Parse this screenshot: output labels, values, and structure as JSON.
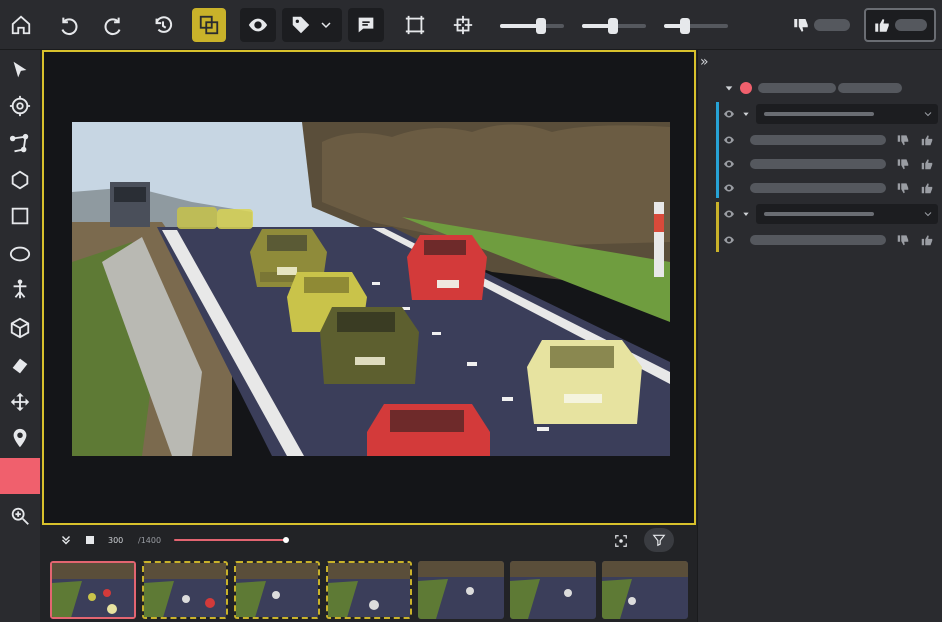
{
  "toolbar": {
    "buttons": [
      "home-icon",
      "undo-icon",
      "redo-icon",
      "history-icon",
      "compare-icon",
      "eye-icon",
      "tag-icon",
      "comment-icon",
      "fit-box-icon",
      "crosshair-box-icon"
    ],
    "active_button": "compare-icon",
    "sliders": [
      {
        "name": "brightness",
        "level": 0.6
      },
      {
        "name": "contrast",
        "level": 0.35
      },
      {
        "name": "opacity",
        "level": 0.2
      }
    ],
    "accent_color": "#c9b22a"
  },
  "left_tools": [
    "cursor-icon",
    "target-icon",
    "polyline-icon",
    "polygon-icon",
    "rectangle-icon",
    "ellipse-icon",
    "skeleton-icon",
    "cuboid-icon",
    "brush-icon",
    "move-icon",
    "pin-icon",
    "zoom-icon"
  ],
  "active_color": "#f0606d",
  "timeline": {
    "current_frame": "300",
    "total_frames": "/1400",
    "progress": 0.3
  },
  "filmstrip": {
    "thumb_count": 7,
    "selected_index": 0
  },
  "panel": {
    "collapse_glyph": "»",
    "status_color": "#f0606d",
    "group_colors": [
      "#27a3d6",
      "#c9b22a"
    ]
  }
}
